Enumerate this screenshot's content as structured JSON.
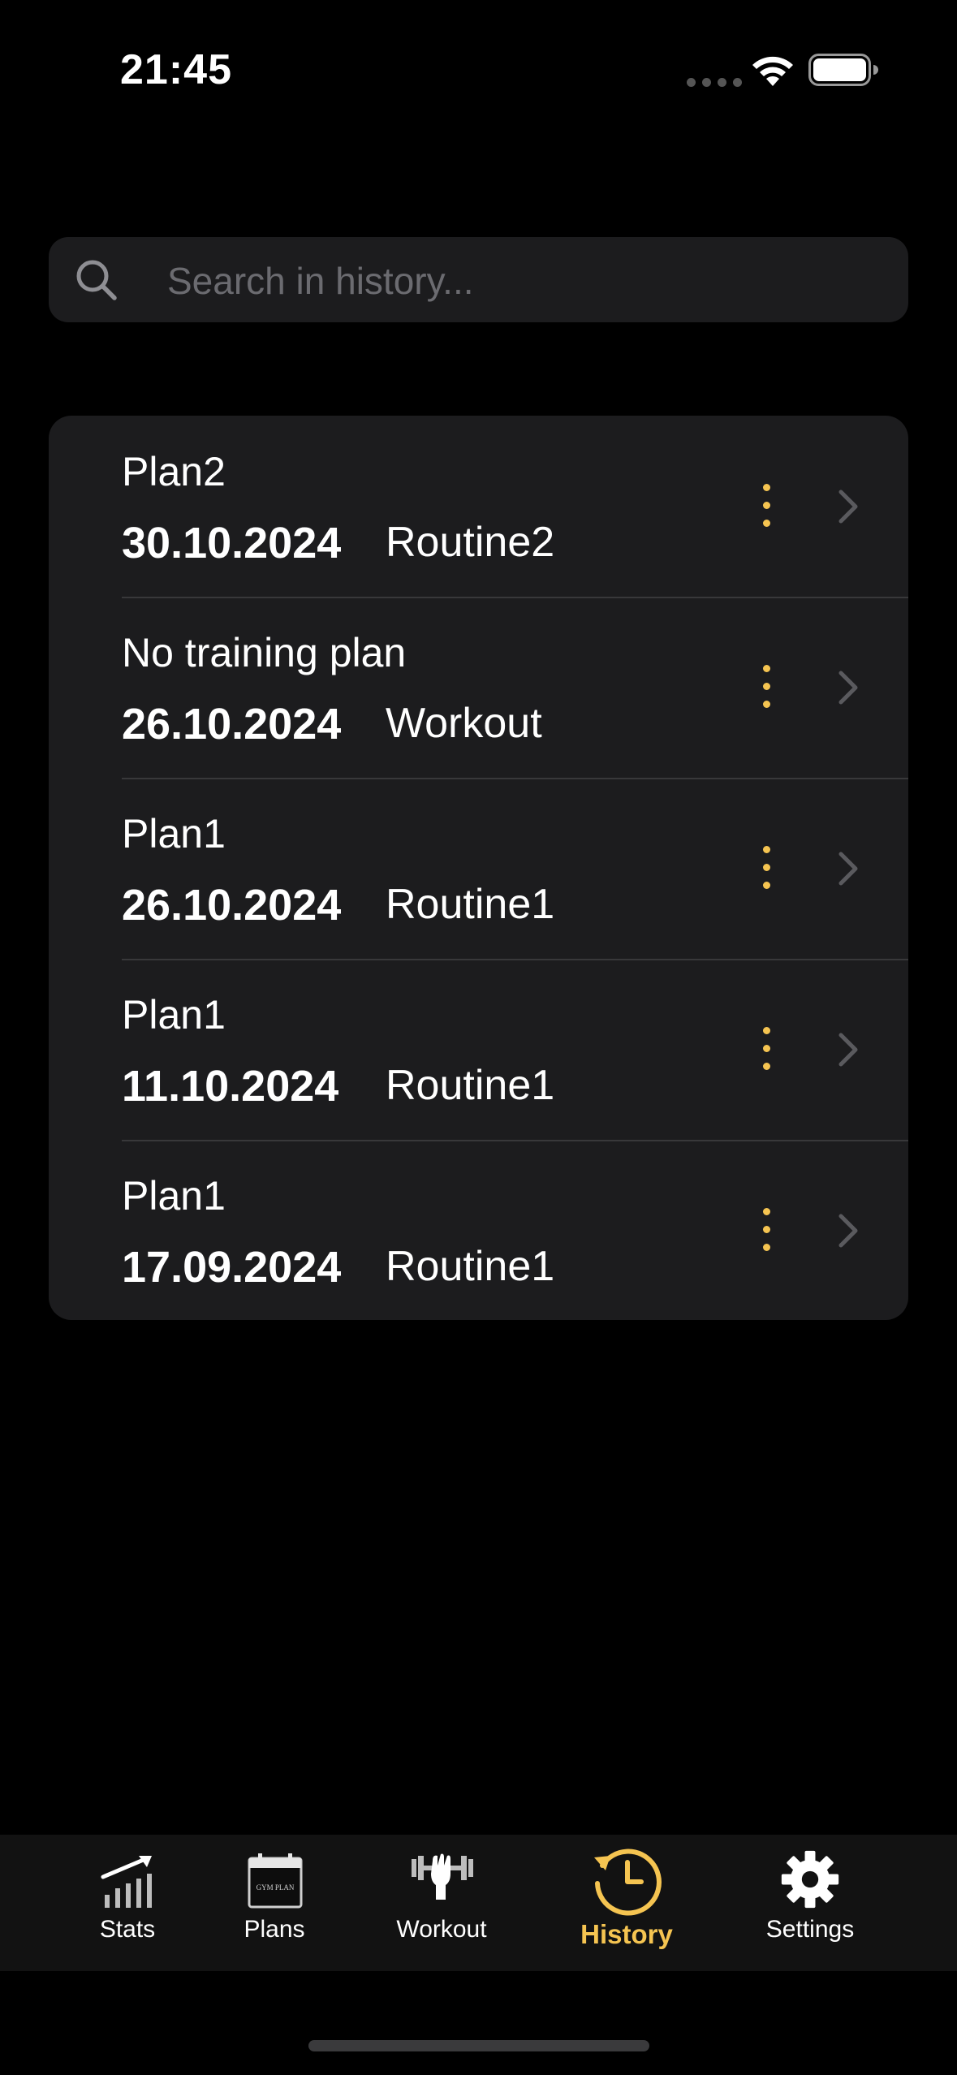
{
  "status_bar": {
    "time": "21:45"
  },
  "search": {
    "placeholder": "Search in history..."
  },
  "history": [
    {
      "plan": "Plan2",
      "date": "30.10.2024",
      "routine": "Routine2"
    },
    {
      "plan": "No training plan",
      "date": "26.10.2024",
      "routine": "Workout"
    },
    {
      "plan": "Plan1",
      "date": "26.10.2024",
      "routine": "Routine1"
    },
    {
      "plan": "Plan1",
      "date": "11.10.2024",
      "routine": "Routine1"
    },
    {
      "plan": "Plan1",
      "date": "17.09.2024",
      "routine": "Routine1"
    }
  ],
  "tabs": [
    {
      "label": "Stats",
      "icon": "stats-chart-icon"
    },
    {
      "label": "Plans",
      "icon": "calendar-icon",
      "icon_text": "GYM PLAN"
    },
    {
      "label": "Workout",
      "icon": "dumbbell-icon"
    },
    {
      "label": "History",
      "icon": "history-clock-icon",
      "active": true
    },
    {
      "label": "Settings",
      "icon": "gear-icon"
    }
  ],
  "colors": {
    "accent": "#f5c451",
    "background": "#000000",
    "card": "#1c1c1e",
    "separator": "#38383a",
    "chevron": "#5a5a5e",
    "placeholder": "#6b6b70"
  }
}
